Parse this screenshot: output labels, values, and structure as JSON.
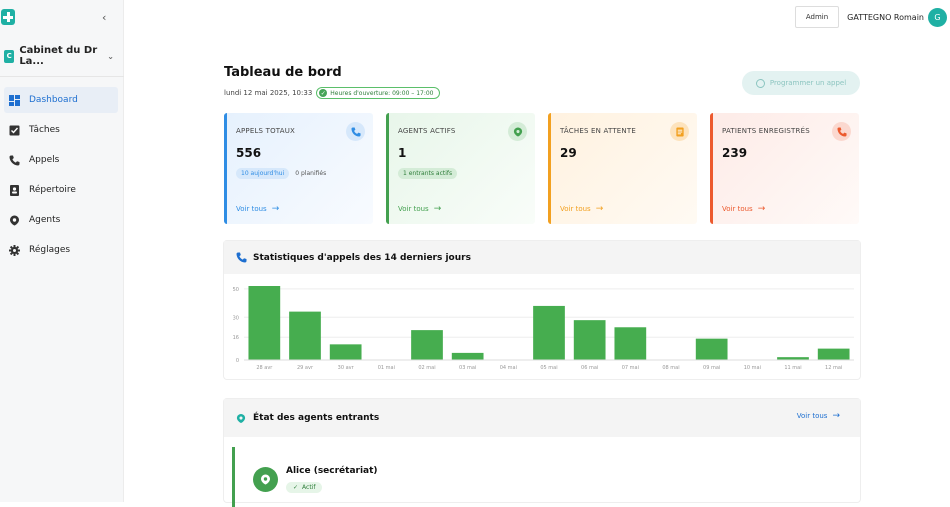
{
  "sidebar": {
    "cabinet_initial": "C",
    "cabinet_name": "Cabinet du Dr La...",
    "items": [
      {
        "label": "Dashboard",
        "icon": "dashboard-icon",
        "active": true
      },
      {
        "label": "Tâches",
        "icon": "task-check-icon"
      },
      {
        "label": "Appels",
        "icon": "phone-icon"
      },
      {
        "label": "Répertoire",
        "icon": "contacts-icon"
      },
      {
        "label": "Agents",
        "icon": "agent-pin-icon"
      },
      {
        "label": "Réglages",
        "icon": "gear-icon"
      }
    ]
  },
  "topbar": {
    "admin_label": "Admin",
    "user_name": "GATTEGNO Romain",
    "avatar_initial": "G"
  },
  "header": {
    "title": "Tableau de bord",
    "datetime": "lundi 12 mai 2025, 10:33",
    "hours": "Heures d'ouverture: 09:00 – 17:00",
    "schedule_button": "Programmer un appel"
  },
  "cards": [
    {
      "label": "APPELS TOTAUX",
      "value": "556",
      "pill": "10 aujourd'hui",
      "extra": "0 planifiés",
      "link": "Voir tous",
      "icon": "phone-icon",
      "color": "#2f8de4"
    },
    {
      "label": "AGENTS ACTIFS",
      "value": "1",
      "pill": "1 entrants actifs",
      "extra": "",
      "link": "Voir tous",
      "icon": "agent-pin-icon",
      "color": "#43a04f"
    },
    {
      "label": "TÂCHES EN ATTENTE",
      "value": "29",
      "pill": "",
      "extra": "",
      "link": "Voir tous",
      "icon": "clipboard-icon",
      "color": "#f2a020"
    },
    {
      "label": "PATIENTS ENREGISTRÉS",
      "value": "239",
      "pill": "",
      "extra": "",
      "link": "Voir tous",
      "icon": "phone-icon",
      "color": "#ec5a2e"
    }
  ],
  "stats_title": "Statistiques d'appels des 14 derniers jours",
  "chart_data": {
    "type": "bar",
    "title": "Statistiques d'appels des 14 derniers jours",
    "categories": [
      "28 avr",
      "29 avr",
      "30 avr",
      "01 mai",
      "02 mai",
      "03 mai",
      "04 mai",
      "05 mai",
      "06 mai",
      "07 mai",
      "08 mai",
      "09 mai",
      "10 mai",
      "11 mai",
      "12 mai"
    ],
    "values": [
      52,
      34,
      11,
      0,
      21,
      5,
      0,
      38,
      28,
      23,
      0,
      15,
      0,
      2,
      8
    ],
    "ylim": [
      0,
      52
    ],
    "yticks": [
      0,
      16,
      30,
      50
    ],
    "color": "#46ad4f",
    "grid": true
  },
  "agents": {
    "title": "État des agents entrants",
    "link": "Voir tous",
    "items": [
      {
        "name": "Alice (secrétariat)",
        "status": "Actif"
      }
    ]
  }
}
